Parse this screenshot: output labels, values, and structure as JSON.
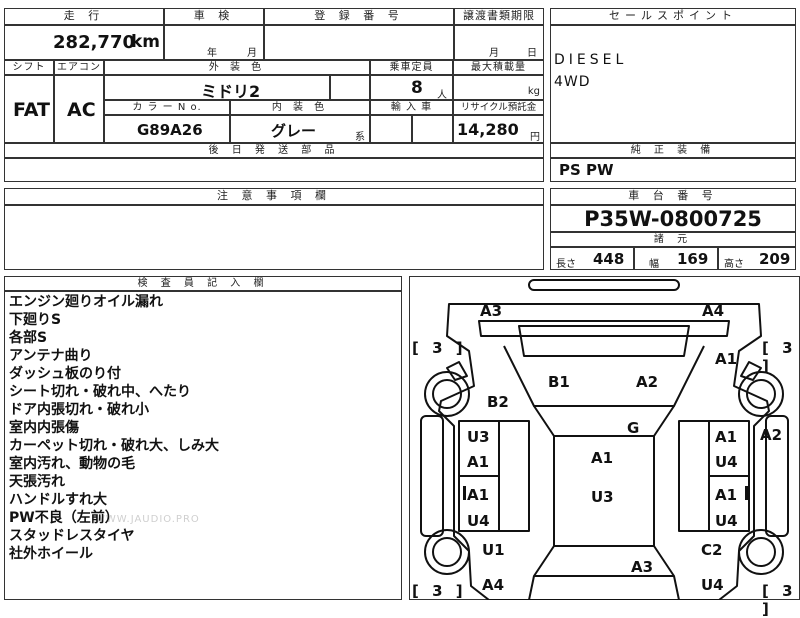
{
  "header": {
    "mileage_label": "走 行",
    "inspection_label": "車 検",
    "registration_label": "登 録 番 号",
    "transfer_deadline_label": "譲渡書類期限",
    "sales_point_label": "セールスポイント",
    "shift_label": "シフト",
    "aircon_label": "エアコン",
    "exterior_color_label": "外 装 色",
    "capacity_label": "乗車定員",
    "max_load_label": "最大積載量",
    "color_no_label": "カ ラ ー N o.",
    "interior_color_label": "内 装 色",
    "import_label": "輸 入 車",
    "recycle_label": "リサイクル預託金",
    "later_parts_label": "後 日 発 送 部 品",
    "genuine_equip_label": "純 正 装 備",
    "notes_label": "注 意 事 項 欄",
    "chassis_label": "車 台 番 号",
    "specs_label": "諸 元",
    "inspector_label": "検 査 員 記 入 欄"
  },
  "values": {
    "mileage": "282,770",
    "mileage_unit": "km",
    "inspection_year_unit": "年",
    "inspection_month_unit": "月",
    "deadline_month_unit": "月",
    "deadline_day_unit": "日",
    "shift": "FAT",
    "aircon": "AC",
    "exterior_color": "ミドリ2",
    "capacity": "8",
    "capacity_unit": "人",
    "max_load_unit": "kg",
    "color_no": "G89A26",
    "interior_color": "グレー",
    "interior_suffix": "系",
    "recycle_fee": "14,280",
    "recycle_unit": "円",
    "chassis_no": "P35W-0800725",
    "length_label": "長さ",
    "length": "448",
    "width_label": "幅",
    "width": "169",
    "height_label": "高さ",
    "height": "209"
  },
  "sales_points": [
    "DIESEL",
    "4WD"
  ],
  "genuine_equipment": "PS PW",
  "inspector_notes": [
    "エンジン廻りオイル漏れ",
    "下廻りS",
    "各部S",
    "アンテナ曲り",
    "ダッシュ板のり付",
    "シート切れ・破れ中、へたり",
    "ドア内張切れ・破れ小",
    "室内内張傷",
    "カーペット切れ・破れ大、しみ大",
    "室内汚れ、動物の毛",
    "天張汚れ",
    "ハンドルすれ大",
    "PW不良（左前）",
    "スタッドレスタイヤ",
    "社外ホイール"
  ],
  "watermark": "WWW.JAUDIO.PRO",
  "diagram": {
    "tire_marks": [
      "[ 3 ]",
      "[ 3 ]",
      "[ 3 ]",
      "[ 3 ]"
    ],
    "damage_codes": [
      "A3",
      "A4",
      "A1",
      "B1",
      "A2",
      "B2",
      "A2",
      "U3",
      "G",
      "A1",
      "A1",
      "A1",
      "U4",
      "A1",
      "U3",
      "U4",
      "A1",
      "U4",
      "U1",
      "C2",
      "A3",
      "A4",
      "U4"
    ]
  }
}
